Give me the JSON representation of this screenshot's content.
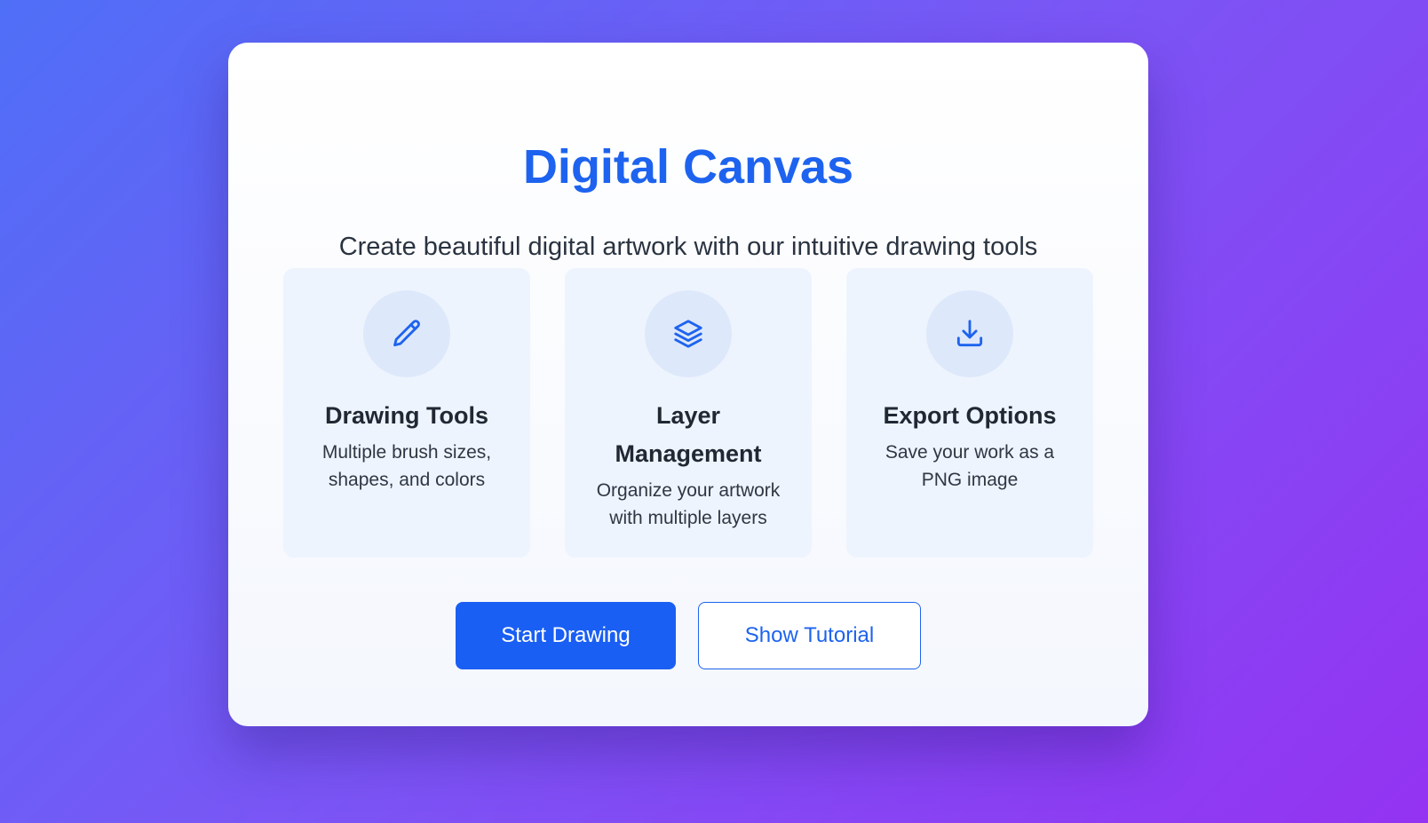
{
  "colors": {
    "accent": "#1d63ef",
    "primary_button": "#1a5ff3",
    "background_start": "#4f6ff7",
    "background_end": "#9433f2"
  },
  "header": {
    "title": "Digital Canvas",
    "subtitle": "Create beautiful digital artwork with our intuitive drawing tools"
  },
  "features": [
    {
      "icon": "pencil-icon",
      "title": "Drawing Tools",
      "description": "Multiple brush sizes, shapes, and colors"
    },
    {
      "icon": "layers-icon",
      "title": "Layer Management",
      "description": "Organize your artwork with multiple layers"
    },
    {
      "icon": "download-icon",
      "title": "Export Options",
      "description": "Save your work as a PNG image"
    }
  ],
  "actions": {
    "start_label": "Start Drawing",
    "tutorial_label": "Show Tutorial"
  }
}
